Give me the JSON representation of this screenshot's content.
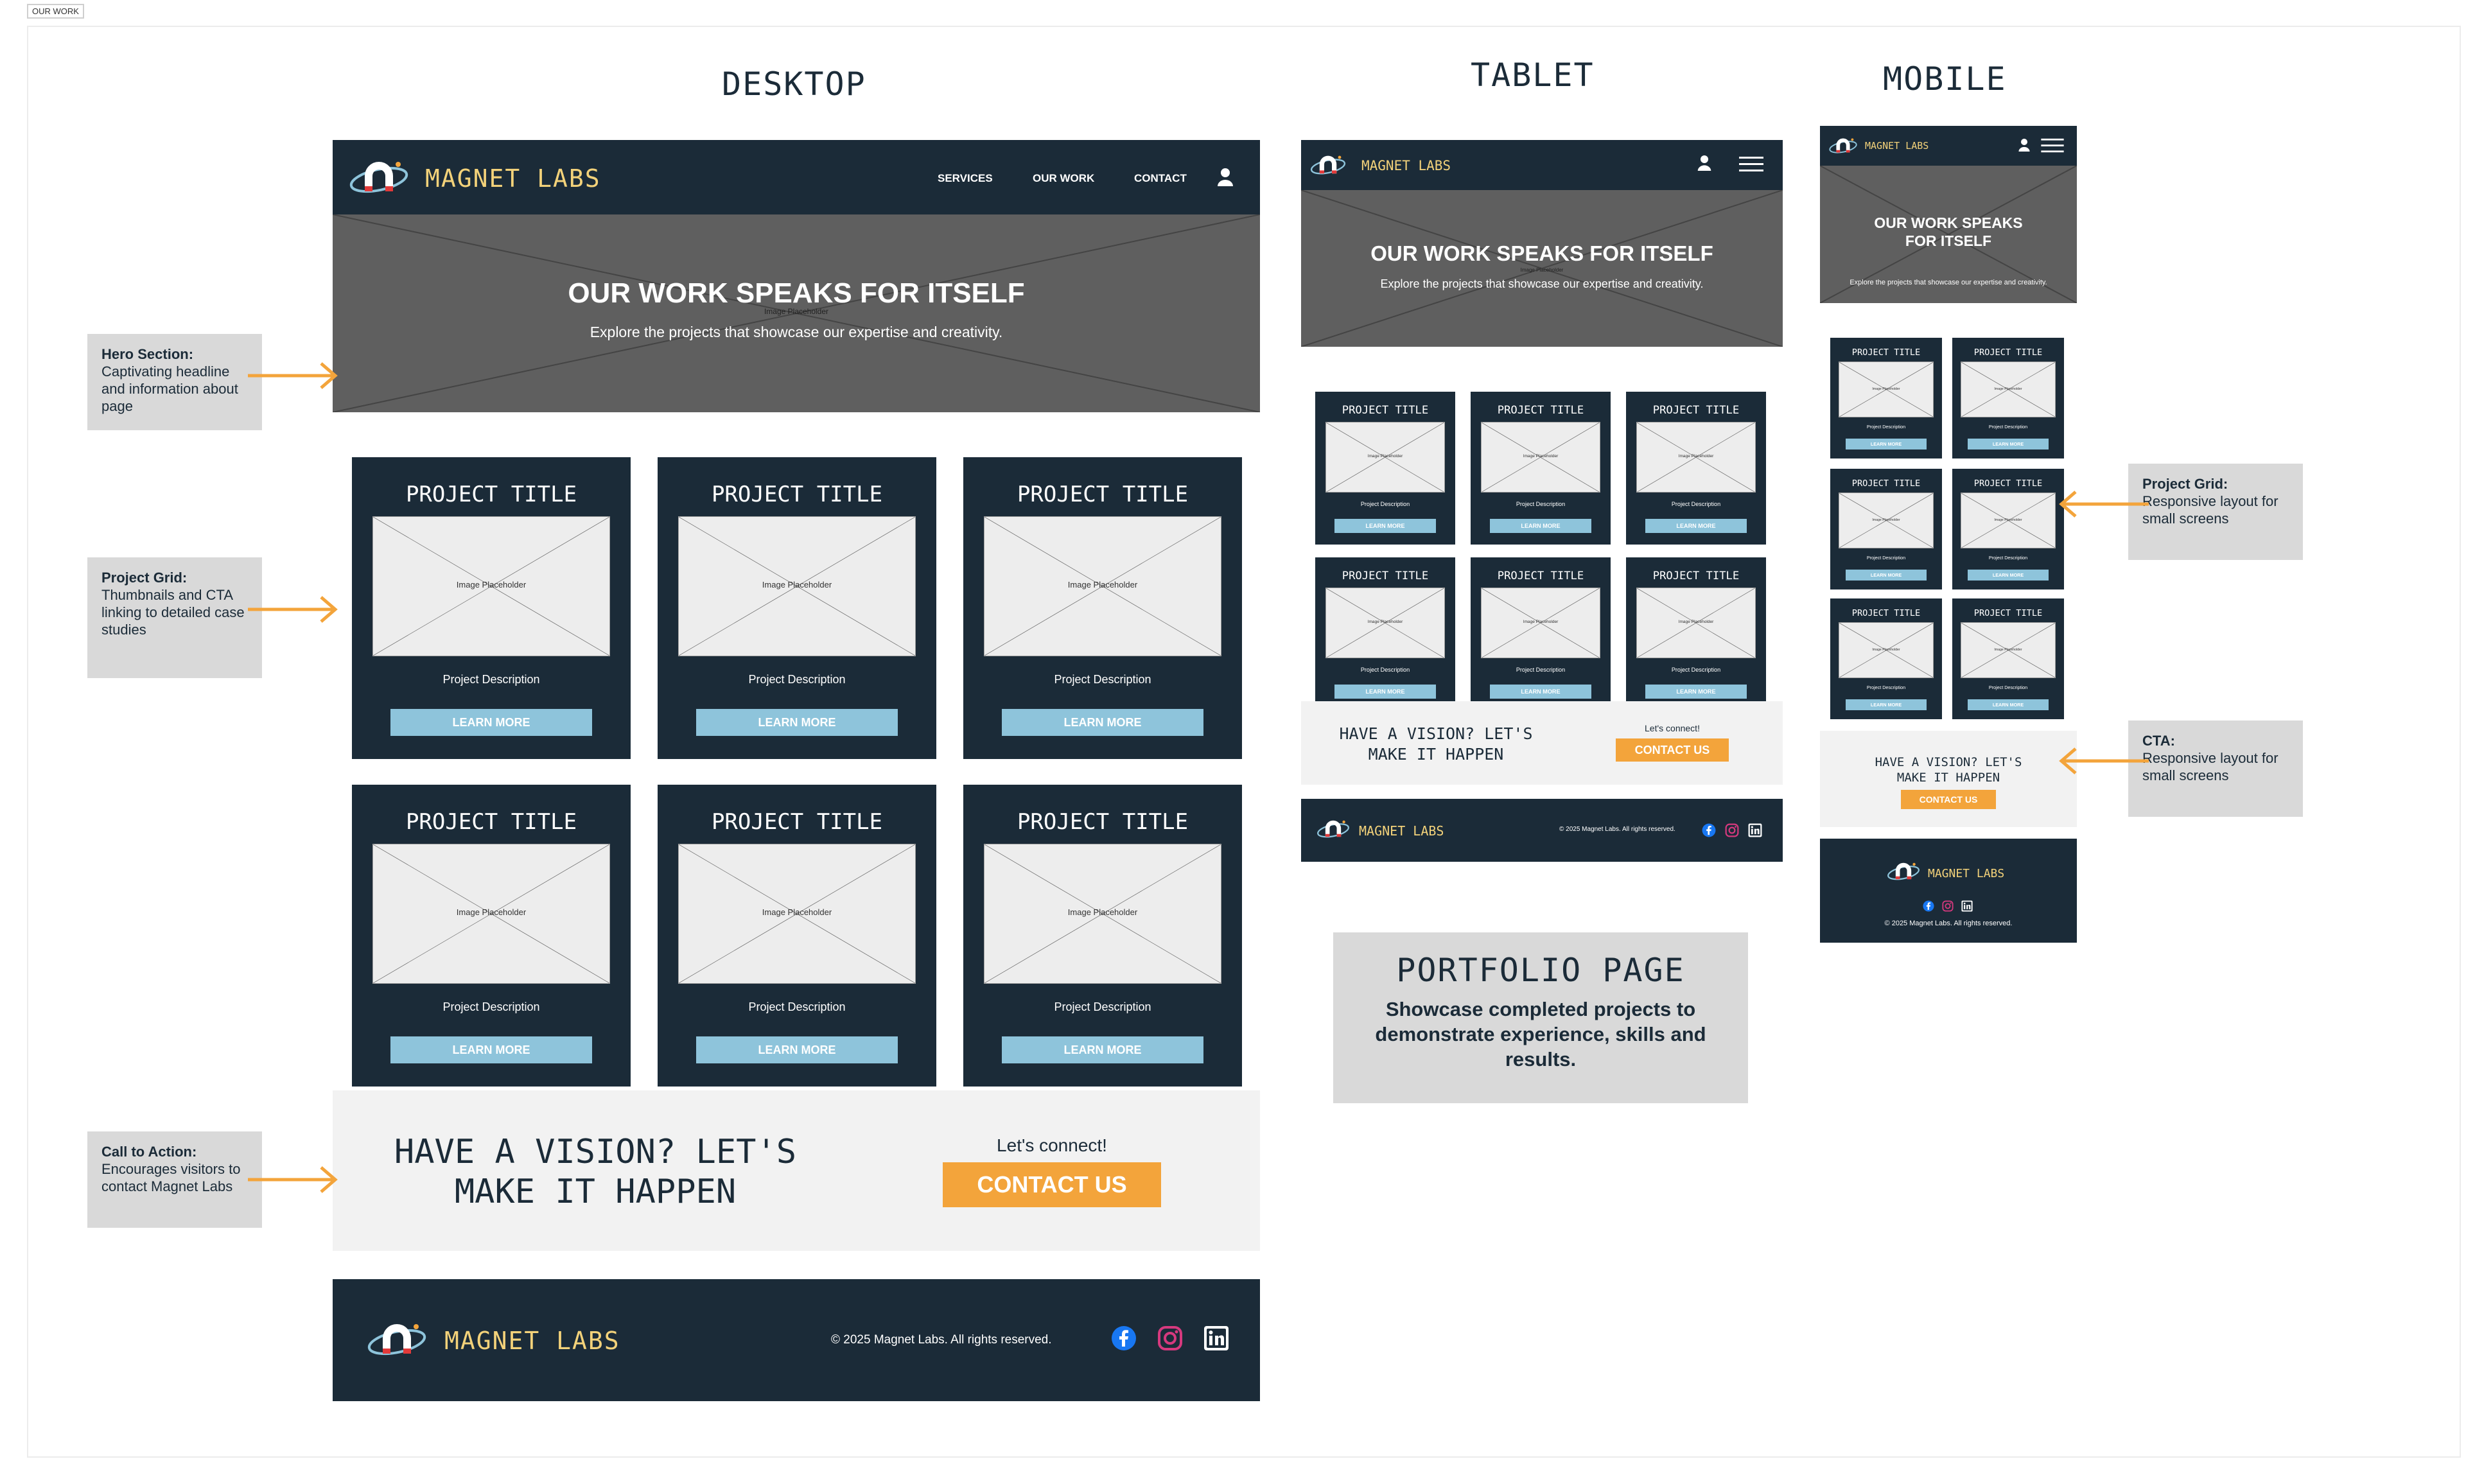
{
  "frame_label": "OUR WORK",
  "colors": {
    "navy": "#1b2b38",
    "accent_blue": "#8ec4db",
    "orange": "#f3a43b",
    "hero_gray": "#5f5f5f",
    "light_panel": "#f2f2f2",
    "annotation_gray": "#d9d9d9"
  },
  "breakpoints": {
    "desktop": "DESKTOP",
    "tablet": "TABLET",
    "mobile": "MOBILE"
  },
  "brand": {
    "name": "MAGNET LABS",
    "logo_icon": "magnet-orbit-logo"
  },
  "nav": {
    "services": "SERVICES",
    "our_work": "OUR WORK",
    "contact": "CONTACT",
    "user_icon": "user-icon",
    "menu_icon": "hamburger-menu-icon"
  },
  "hero": {
    "headline": "OUR WORK SPEAKS FOR ITSELF",
    "mobile_headline_line1": "OUR WORK SPEAKS",
    "mobile_headline_line2": "FOR ITSELF",
    "subtext": "Explore the projects that showcase our expertise and creativity.",
    "placeholder": "Image Placeholder"
  },
  "project_card": {
    "title": "PROJECT TITLE",
    "image_label": "Image Placeholder",
    "description": "Project Description",
    "button": "LEARN MORE"
  },
  "cta": {
    "line1": "HAVE A VISION? LET'S",
    "line2": "MAKE IT HAPPEN",
    "lead": "Let's connect!",
    "button": "CONTACT US"
  },
  "footer": {
    "copyright": "© 2025 Magnet Labs. All rights reserved.",
    "social": [
      "facebook-icon",
      "instagram-icon",
      "linkedin-icon"
    ]
  },
  "annotations": {
    "hero": {
      "title": "Hero Section:",
      "body": "Captivating headline and information about page"
    },
    "grid": {
      "title": "Project Grid:",
      "body": "Thumbnails and CTA linking to detailed case studies"
    },
    "cta": {
      "title": "Call to Action:",
      "body": "Encourages visitors to contact Magnet Labs"
    },
    "mobile_grid": {
      "title": "Project Grid:",
      "body": "Responsive layout for small screens"
    },
    "mobile_cta": {
      "title": "CTA:",
      "body": "Responsive layout for small screens"
    }
  },
  "page_info": {
    "title": "PORTFOLIO PAGE",
    "body": "Showcase completed projects to demonstrate experience, skills and results."
  }
}
